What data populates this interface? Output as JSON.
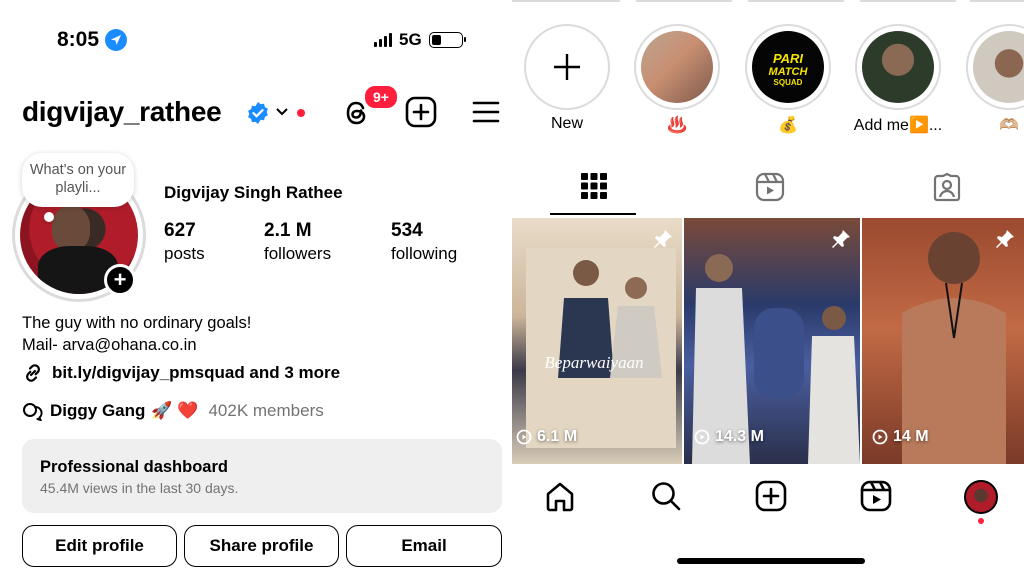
{
  "status_bar": {
    "time": "8:05",
    "network": "5G"
  },
  "header": {
    "username": "digvijay_rathee",
    "notification_badge": "9+"
  },
  "note": {
    "text": "What's on your playli..."
  },
  "profile": {
    "full_name": "Digvijay Singh Rathee",
    "stats": [
      {
        "value": "627",
        "label": "posts"
      },
      {
        "value": "2.1 M",
        "label": "followers"
      },
      {
        "value": "534",
        "label": "following"
      }
    ],
    "bio_line1": "The guy with no ordinary goals!",
    "bio_line2": "Mail- arva@ohana.co.in",
    "link": "bit.ly/digvijay_pmsquad and 3 more",
    "channel_name": "Diggy Gang",
    "channel_emoji": "🚀 ❤️",
    "channel_members": "402K members"
  },
  "dashboard": {
    "title": "Professional dashboard",
    "subtitle": "45.4M views in the last 30 days."
  },
  "buttons": {
    "edit": "Edit profile",
    "share": "Share profile",
    "email": "Email"
  },
  "stories": [
    {
      "caption": "New"
    },
    {
      "caption": "♨️"
    },
    {
      "caption": "💰"
    },
    {
      "caption": "Add me▶️..."
    },
    {
      "caption": "🫶🏼"
    }
  ],
  "story_logo_text": "PARI MATCH SQUAD",
  "posts": [
    {
      "views": "6.1 M",
      "title": "Beparwaiyaan"
    },
    {
      "views": "14.3 M"
    },
    {
      "views": "14 M"
    }
  ],
  "colors": {
    "accent_red": "#ff1f3d",
    "verified_blue": "#1a8cff",
    "dashboard_bg": "#efefef"
  }
}
